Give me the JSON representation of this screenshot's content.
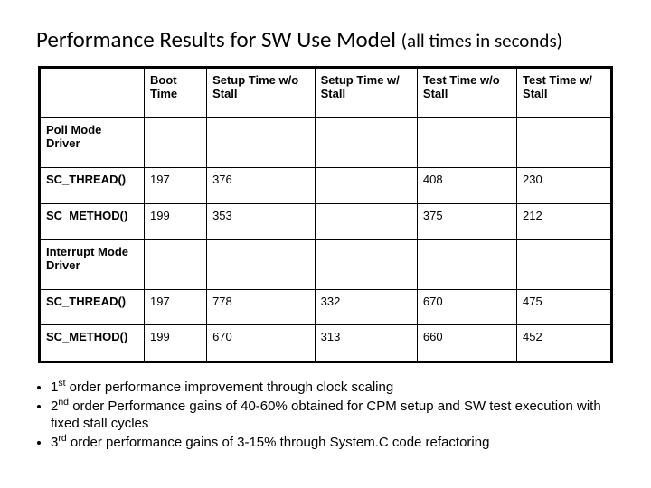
{
  "title_main": "Performance Results for SW Use Model",
  "title_sub": "(all times in seconds)",
  "table": {
    "headers": [
      "Boot Time",
      "Setup Time w/o Stall",
      "Setup Time w/ Stall",
      "Test Time w/o Stall",
      "Test Time w/ Stall"
    ],
    "sections": [
      {
        "label": "Poll Mode Driver",
        "rows": [
          {
            "label": "SC_THREAD()",
            "cells": [
              "197",
              "376",
              "",
              "408",
              "230"
            ]
          },
          {
            "label": "SC_METHOD()",
            "cells": [
              "199",
              "353",
              "",
              "375",
              "212"
            ]
          }
        ]
      },
      {
        "label": "Interrupt Mode Driver",
        "rows": [
          {
            "label": "SC_THREAD()",
            "cells": [
              "197",
              "778",
              "332",
              "670",
              "475"
            ]
          },
          {
            "label": "SC_METHOD()",
            "cells": [
              "199",
              "670",
              "313",
              "660",
              "452"
            ]
          }
        ]
      }
    ]
  },
  "bullets": [
    {
      "ord_num": "1",
      "ord_suf": "st",
      "text": " order performance improvement through clock scaling"
    },
    {
      "ord_num": "2",
      "ord_suf": "nd",
      "text": " order Performance gains of 40-60% obtained for CPM setup and SW test execution with fixed stall cycles"
    },
    {
      "ord_num": "3",
      "ord_suf": "rd",
      "text": " order performance gains of 3-15% through System.C code refactoring"
    }
  ]
}
